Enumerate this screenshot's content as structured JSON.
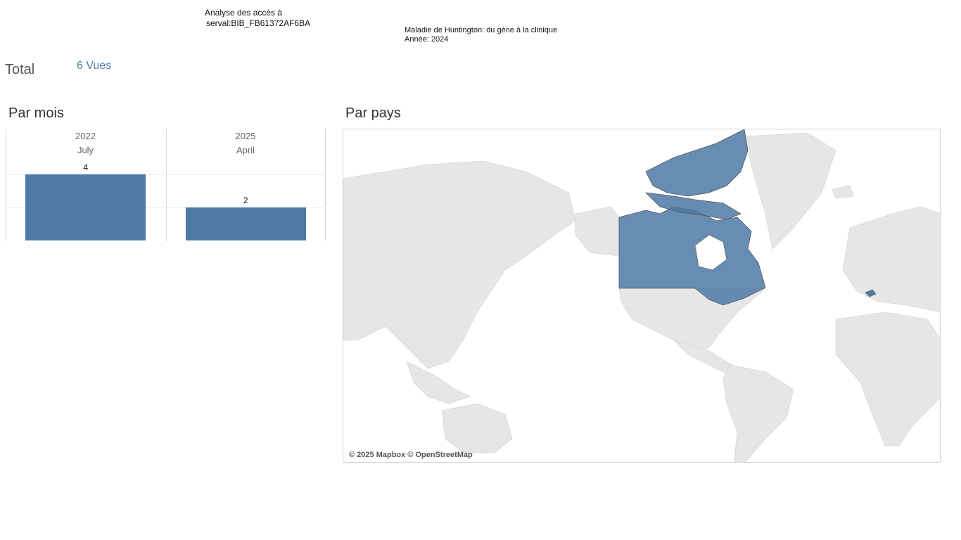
{
  "header": {
    "title_line1": "Analyse des accès à",
    "title_line2": "serval:BIB_FB61372AF6BA"
  },
  "document": {
    "name": "Maladie de Huntington: du gène à la clinique",
    "year_line": "Année: 2024"
  },
  "total": {
    "label": "Total",
    "value": "6 Vues"
  },
  "sections": {
    "by_month": "Par mois",
    "by_country": "Par pays"
  },
  "chart_data": {
    "type": "bar",
    "categories": [
      "2022 July",
      "2025 April"
    ],
    "years": [
      "2022",
      "2025"
    ],
    "months": [
      "July",
      "April"
    ],
    "values": [
      4,
      2
    ],
    "value_labels": [
      "4",
      "2"
    ],
    "ylim": [
      0,
      4
    ],
    "color": "#4e79a7",
    "grid": true
  },
  "map": {
    "highlighted_countries": [
      "Canada",
      "Switzerland"
    ],
    "highlight_color": "#4e79a7",
    "attribution": "© 2025 Mapbox © OpenStreetMap"
  }
}
